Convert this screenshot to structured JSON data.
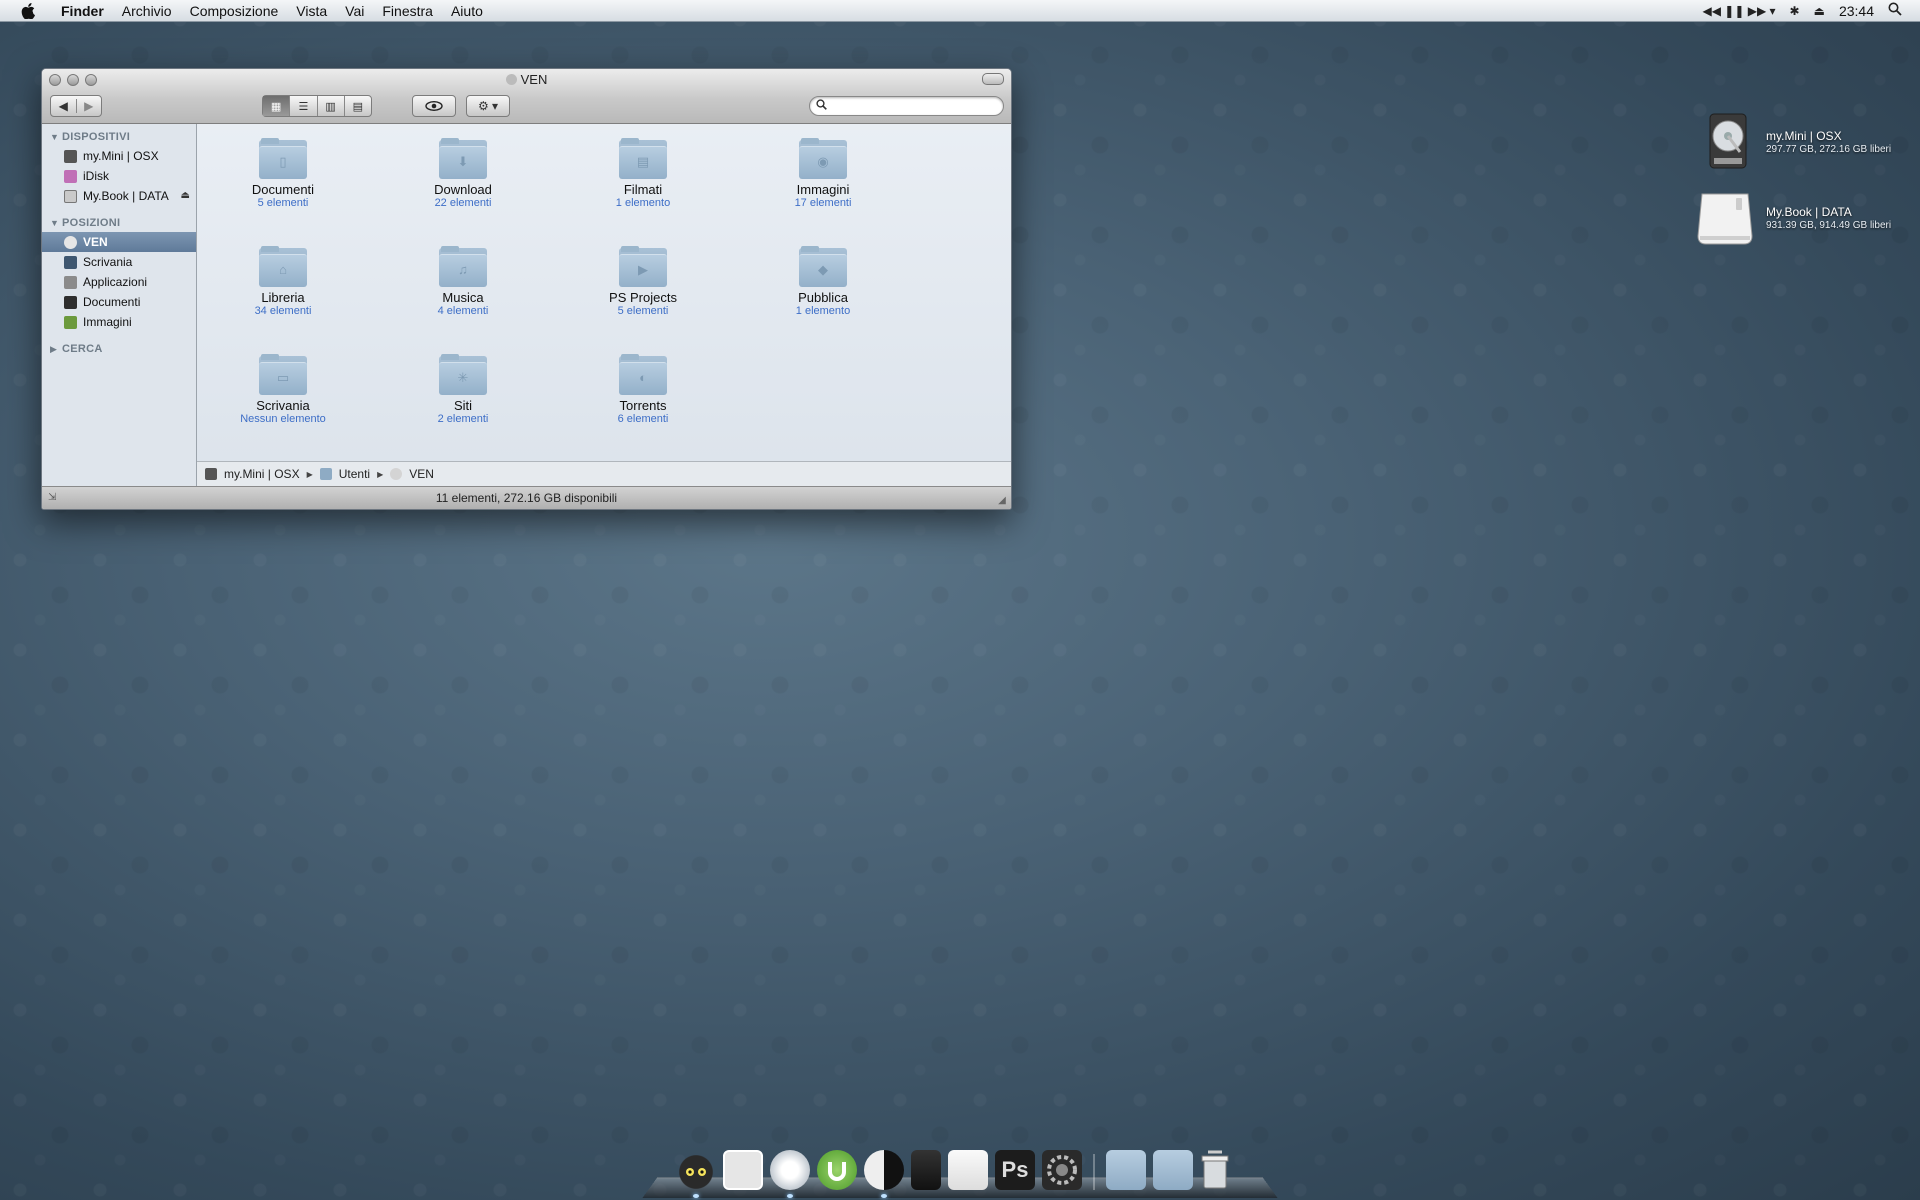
{
  "menubar": {
    "app": "Finder",
    "items": [
      "Archivio",
      "Composizione",
      "Vista",
      "Vai",
      "Finestra",
      "Aiuto"
    ],
    "clock": "23:44"
  },
  "window": {
    "title": "VEN",
    "search_placeholder": "",
    "sidebar": {
      "devices_label": "DISPOSITIVI",
      "devices": [
        "my.Mini | OSX",
        "iDisk",
        "My.Book | DATA"
      ],
      "places_label": "POSIZIONI",
      "places": [
        "VEN",
        "Scrivania",
        "Applicazioni",
        "Documenti",
        "Immagini"
      ],
      "search_label": "CERCA"
    },
    "items": [
      {
        "name": "Documenti",
        "count": "5 elementi"
      },
      {
        "name": "Download",
        "count": "22 elementi"
      },
      {
        "name": "Filmati",
        "count": "1 elemento"
      },
      {
        "name": "Immagini",
        "count": "17 elementi"
      },
      {
        "name": "Libreria",
        "count": "34 elementi"
      },
      {
        "name": "Musica",
        "count": "4 elementi"
      },
      {
        "name": "PS Projects",
        "count": "5 elementi"
      },
      {
        "name": "Pubblica",
        "count": "1 elemento"
      },
      {
        "name": "Scrivania",
        "count": "Nessun elemento"
      },
      {
        "name": "Siti",
        "count": "2 elementi"
      },
      {
        "name": "Torrents",
        "count": "6 elementi"
      }
    ],
    "path": [
      "my.Mini | OSX",
      "Utenti",
      "VEN"
    ],
    "status": "11 elementi, 272.16 GB disponibili"
  },
  "desktop": {
    "drives": [
      {
        "name": "my.Mini | OSX",
        "info": "297.77 GB, 272.16 GB liberi"
      },
      {
        "name": "My.Book | DATA",
        "info": "931.39 GB, 914.49 GB liberi"
      }
    ]
  },
  "icon_names": {
    "dock": [
      "adium-icon",
      "mail-icon",
      "safari-icon",
      "utorrent-icon",
      "itunes-icon",
      "camera-icon",
      "ichat-icon",
      "photoshop-icon",
      "system-preferences-icon",
      "applications-stack-icon",
      "downloads-stack-icon",
      "trash-icon"
    ]
  },
  "dock_labels": {
    "photoshop": "Ps"
  }
}
